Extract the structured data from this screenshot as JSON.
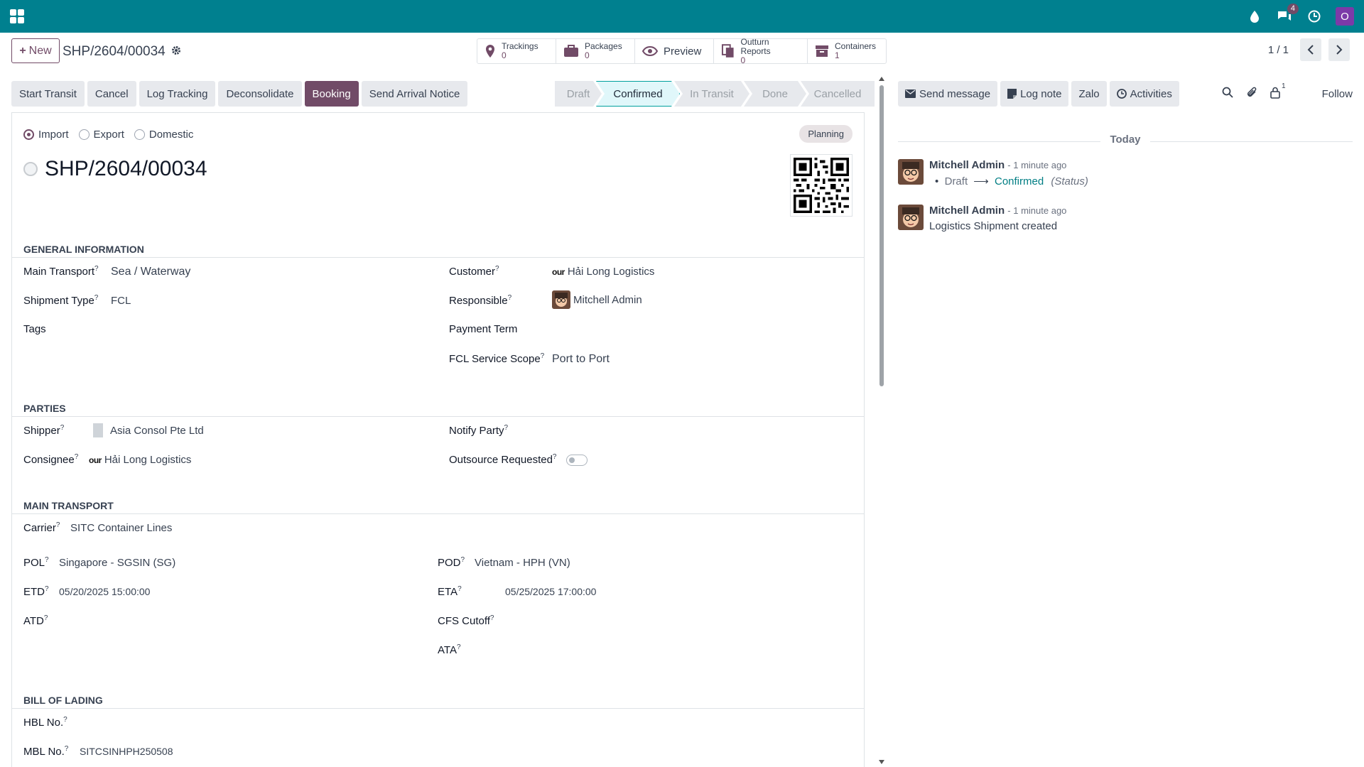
{
  "navbar": {
    "messages_badge": "4",
    "user_initial": "O"
  },
  "control": {
    "new_label": "New",
    "record_ref": "SHP/2604/00034",
    "smart_buttons": [
      {
        "label": "Trackings",
        "count": "0"
      },
      {
        "label": "Packages",
        "count": "0"
      },
      {
        "label": "Preview"
      },
      {
        "label": "Outturn Reports",
        "count": "0"
      },
      {
        "label": "Containers",
        "count": "1"
      }
    ],
    "pager": "1 / 1"
  },
  "actions": [
    "Start Transit",
    "Cancel",
    "Log Tracking",
    "Deconsolidate",
    "Booking",
    "Send Arrival Notice"
  ],
  "stages": [
    "Draft",
    "Confirmed",
    "In Transit",
    "Done",
    "Cancelled"
  ],
  "active_stage": "Confirmed",
  "form": {
    "direction_options": [
      "Import",
      "Export",
      "Domestic"
    ],
    "direction_selected": "Import",
    "planning_badge": "Planning",
    "title": "SHP/2604/00034",
    "sections": {
      "general": "GENERAL INFORMATION",
      "parties": "PARTIES",
      "main_transport": "MAIN TRANSPORT",
      "bill_of_lading": "BILL OF LADING"
    },
    "general": {
      "main_transport_label": "Main Transport",
      "main_transport": "Sea / Waterway",
      "shipment_type_label": "Shipment Type",
      "shipment_type": "FCL",
      "tags_label": "Tags",
      "customer_label": "Customer",
      "customer_logo": "our",
      "customer": "Hải Long Logistics",
      "responsible_label": "Responsible",
      "responsible": "Mitchell Admin",
      "payment_term_label": "Payment Term",
      "fcl_scope_label": "FCL Service Scope",
      "fcl_scope": "Port to Port"
    },
    "parties": {
      "shipper_label": "Shipper",
      "shipper": "Asia Consol Pte Ltd",
      "consignee_label": "Consignee",
      "consignee_logo": "our",
      "consignee": "Hải Long Logistics",
      "notify_label": "Notify Party",
      "outsource_label": "Outsource Requested"
    },
    "transport": {
      "carrier_label": "Carrier",
      "carrier": "SITC Container Lines",
      "pol_label": "POL",
      "pol": "Singapore - SGSIN (SG)",
      "pod_label": "POD",
      "pod": "Vietnam - HPH (VN)",
      "etd_label": "ETD",
      "etd": "05/20/2025 15:00:00",
      "eta_label": "ETA",
      "eta": "05/25/2025 17:00:00",
      "atd_label": "ATD",
      "cfs_label": "CFS Cutoff",
      "ata_label": "ATA"
    },
    "bol": {
      "hbl_label": "HBL No.",
      "mbl_label": "MBL No.",
      "mbl": "SITCSINHPH250508"
    }
  },
  "chatter": {
    "send_message": "Send message",
    "log_note": "Log note",
    "zalo": "Zalo",
    "activities": "Activities",
    "followers_count": "1",
    "follow": "Follow",
    "today": "Today",
    "messages": [
      {
        "author": "Mitchell Admin",
        "time": "- 1 minute ago",
        "from": "Draft",
        "to": "Confirmed",
        "field": "(Status)"
      },
      {
        "author": "Mitchell Admin",
        "time": "- 1 minute ago",
        "body": "Logistics Shipment created"
      }
    ]
  },
  "colors": {
    "navbar": "#00808f",
    "primary": "#714b67",
    "active_stage": "#e0f7fa"
  }
}
